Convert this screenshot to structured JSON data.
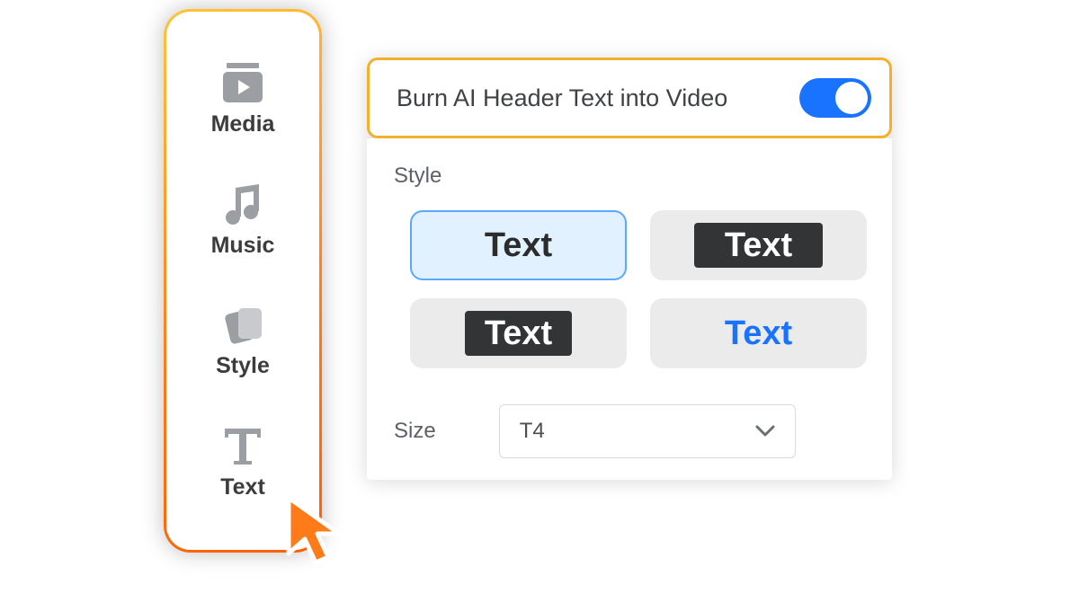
{
  "sidebar": {
    "items": [
      {
        "label": "Media"
      },
      {
        "label": "Music"
      },
      {
        "label": "Style"
      },
      {
        "label": "Text"
      }
    ]
  },
  "panel": {
    "toggle_label": "Burn AI Header Text into Video",
    "toggle_on": true,
    "style_section_label": "Style",
    "style_swatches": [
      {
        "label": "Text"
      },
      {
        "label": "Text"
      },
      {
        "label": "Text"
      },
      {
        "label": "Text"
      }
    ],
    "size_label": "Size",
    "size_value": "T4"
  },
  "colors": {
    "accent": "#1a73ff",
    "sidebar_gradient_start": "#ffc436",
    "sidebar_gradient_end": "#ff5e00",
    "highlight_border": "#f3b02b"
  }
}
